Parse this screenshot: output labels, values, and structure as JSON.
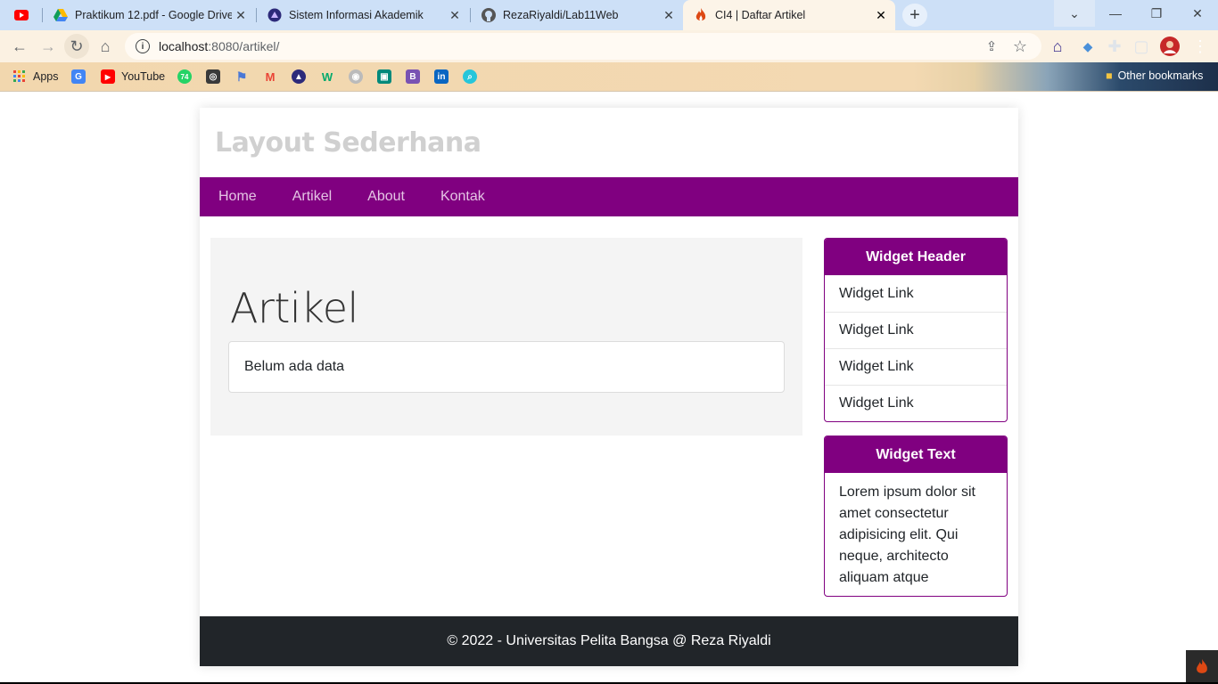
{
  "browser": {
    "tabs": [
      {
        "label": "",
        "icon": "youtube-icon",
        "active": false
      },
      {
        "label": "Praktikum 12.pdf - Google Drive",
        "icon": "google-drive-icon",
        "active": false
      },
      {
        "label": "Sistem Informasi Akademik",
        "icon": "campus-logo-icon",
        "active": false
      },
      {
        "label": "RezaRiyaldi/Lab11Web",
        "icon": "github-icon",
        "active": false
      },
      {
        "label": "CI4 | Daftar Artikel",
        "icon": "codeigniter-icon",
        "active": true
      }
    ],
    "url_host": "localhost",
    "url_path": ":8080/artikel/",
    "bookmarks": [
      {
        "label": "Apps",
        "icon": "apps-grid-icon"
      },
      {
        "label": "",
        "icon": "google-translate-icon"
      },
      {
        "label": "YouTube",
        "icon": "youtube-icon"
      },
      {
        "label": "",
        "icon": "whatsapp-icon"
      },
      {
        "label": "",
        "icon": "github-gray-icon"
      },
      {
        "label": "",
        "icon": "flag-icon"
      },
      {
        "label": "",
        "icon": "gmail-icon"
      },
      {
        "label": "",
        "icon": "campus-logo-icon"
      },
      {
        "label": "",
        "icon": "w3schools-icon"
      },
      {
        "label": "",
        "icon": "github-icon"
      },
      {
        "label": "",
        "icon": "google-meet-icon"
      },
      {
        "label": "",
        "icon": "bootstrap-icon"
      },
      {
        "label": "",
        "icon": "linkedin-icon"
      },
      {
        "label": "",
        "icon": "search-app-icon"
      }
    ],
    "other_bookmarks": "Other bookmarks",
    "colors": {
      "tabbar": "#cde0f7",
      "toolbar": "#fbf1e2",
      "active_tab": "#fcf4e8"
    }
  },
  "page": {
    "site_title": "Layout Sederhana",
    "nav": [
      "Home",
      "Artikel",
      "About",
      "Kontak"
    ],
    "heading": "Artikel",
    "empty_message": "Belum ada data",
    "widget1": {
      "header": "Widget Header",
      "links": [
        "Widget Link",
        "Widget Link",
        "Widget Link",
        "Widget Link"
      ]
    },
    "widget2": {
      "header": "Widget Text",
      "text": "Lorem ipsum dolor sit amet consectetur adipisicing elit. Qui neque, architecto aliquam atque"
    },
    "footer": "© 2022 - Universitas Pelita Bangsa @ Reza Riyaldi",
    "colors": {
      "nav": "#800080",
      "footer": "#212529",
      "title": "#d0d0d0"
    }
  }
}
